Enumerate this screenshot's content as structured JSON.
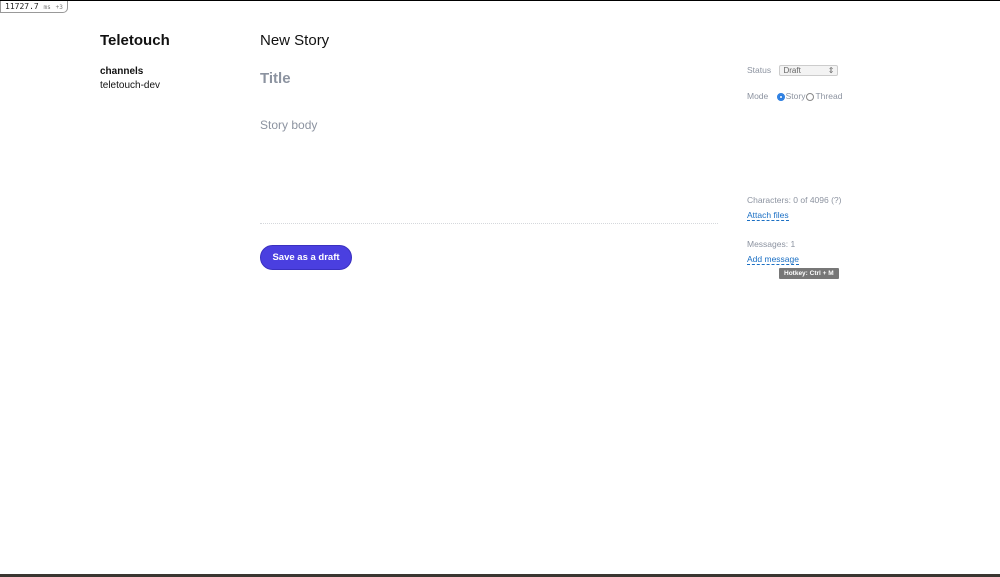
{
  "overlay": {
    "timer": "11727.7",
    "unit": "ms",
    "suffix": "+3"
  },
  "sidebar": {
    "brand": "Teletouch",
    "section_heading": "channels",
    "channels": [
      "teletouch-dev"
    ]
  },
  "main": {
    "page_title": "New Story",
    "title_placeholder": "Title",
    "body_placeholder": "Story body",
    "save_button": "Save as a draft"
  },
  "aside": {
    "status_label": "Status",
    "status_value": "Draft",
    "mode_label": "Mode",
    "mode_options": [
      "Story",
      "Thread"
    ],
    "mode_selected": "Story",
    "characters": "Characters: 0 of 4096 (?)",
    "attach_files": "Attach files",
    "messages": "Messages: 1",
    "add_message": "Add message",
    "tooltip": "Hotkey: Ctrl + M"
  },
  "colors": {
    "accent": "#4a3fe0",
    "link": "#1a6fc4",
    "muted": "#8c93a0"
  }
}
